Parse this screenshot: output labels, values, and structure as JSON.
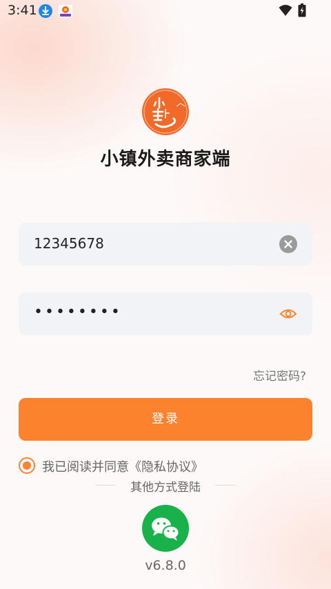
{
  "status_bar": {
    "time": "3:41",
    "icons": [
      "download-icon",
      "app-notification-icon",
      "wifi-icon",
      "battery-charging-icon"
    ]
  },
  "app": {
    "title": "小镇外卖商家端",
    "logo_icon": "xiaozhen-logo",
    "brand_color": "#f26a2a"
  },
  "login_form": {
    "username_value": "12345678",
    "password_value": "••••••••",
    "clear_icon": "clear-icon",
    "show_password_icon": "eye-icon"
  },
  "forgot_password_label": "忘记密码?",
  "login_button_label": "登录",
  "agreement": {
    "text": "我已阅读并同意",
    "link_label": "《隐私协议》",
    "checked": true
  },
  "other_login": {
    "divider_label": "其他方式登陆",
    "wechat_icon": "wechat-icon"
  },
  "version": "v6.8.0",
  "colors": {
    "accent": "#fd822d",
    "wechat_green": "#18b14a",
    "input_bg": "#f1f3f6"
  }
}
